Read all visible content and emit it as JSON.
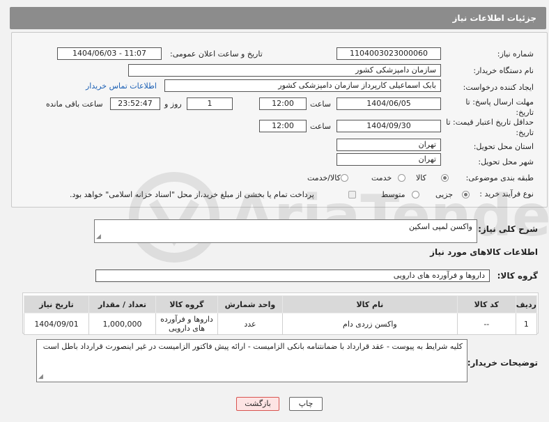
{
  "header": {
    "title": "جزئیات اطلاعات نیاز"
  },
  "form": {
    "need_number": {
      "label": "شماره نیاز:",
      "value": "1104003023000060"
    },
    "announce_datetime": {
      "label": "تاریخ و ساعت اعلان عمومی:",
      "value": "1404/06/03 - 11:07"
    },
    "buyer_org": {
      "label": "نام دستگاه خریدار:",
      "value": "سازمان دامپزشکی کشور"
    },
    "requester": {
      "label": "ایجاد کننده درخواست:",
      "value": "بابک اسماعیلی کارپرداز سازمان دامپزشکی کشور",
      "contact_link": "اطلاعات تماس خریدار"
    },
    "reply_deadline": {
      "label": "مهلت ارسال پاسخ: تا تاریخ:",
      "date": "1404/06/05",
      "time_label": "ساعت",
      "time": "12:00",
      "days": "1",
      "days_label": "روز و",
      "remaining": "23:52:47",
      "remaining_label": "ساعت باقی مانده"
    },
    "price_validity": {
      "label": "حداقل تاریخ اعتبار قیمت: تا تاریخ:",
      "date": "1404/09/30",
      "time_label": "ساعت",
      "time": "12:00"
    },
    "province": {
      "label": "استان محل تحویل:",
      "value": "تهران"
    },
    "city": {
      "label": "شهر محل تحویل:",
      "value": "تهران"
    },
    "category": {
      "label": "طبقه بندی موضوعی:",
      "options": [
        "کالا",
        "خدمت",
        "کالا/خدمت"
      ],
      "selected": "کالا"
    },
    "purchase_type": {
      "label": "نوع فرآیند خرید :",
      "options": [
        "جزیی",
        "متوسط"
      ],
      "selected": "جزیی",
      "payment_note": "پرداخت تمام یا بخشی از مبلغ خرید،از محل \"اسناد خزانه اسلامی\" خواهد بود."
    }
  },
  "description": {
    "label": "شرح کلی نیاز:",
    "value": "واکسن لمپی اسکین"
  },
  "goods_section": {
    "title": "اطلاعات کالاهای مورد نیاز",
    "group_label": "گروه کالا:",
    "group_value": "داروها و فرآورده های دارویی",
    "columns": [
      "ردیف",
      "کد کالا",
      "نام کالا",
      "واحد شمارش",
      "گروه کالا",
      "تعداد / مقدار",
      "تاریخ نیاز"
    ],
    "rows": [
      {
        "row": "1",
        "code": "--",
        "name": "واکسن زردی دام",
        "unit": "عدد",
        "group": "داروها و فرآورده های دارویی",
        "qty": "1,000,000",
        "date": "1404/09/01"
      }
    ]
  },
  "buyer_notes": {
    "label": "توضیحات خریدار:",
    "value": "کلیه شرایط به پیوست - عقد قرارداد با ضمانتنامه بانکی الزامیست -  ارائه پیش فاکتور الزامیست در غیر اینصورت قرارداد باطل است"
  },
  "buttons": {
    "print": "چاپ",
    "back": "بازگشت"
  },
  "watermark": {
    "text": "AriaTender.neT"
  },
  "colors": {
    "header_bg": "#8c8c8c",
    "link": "#1a5fb4",
    "back_border": "#d9534f"
  }
}
